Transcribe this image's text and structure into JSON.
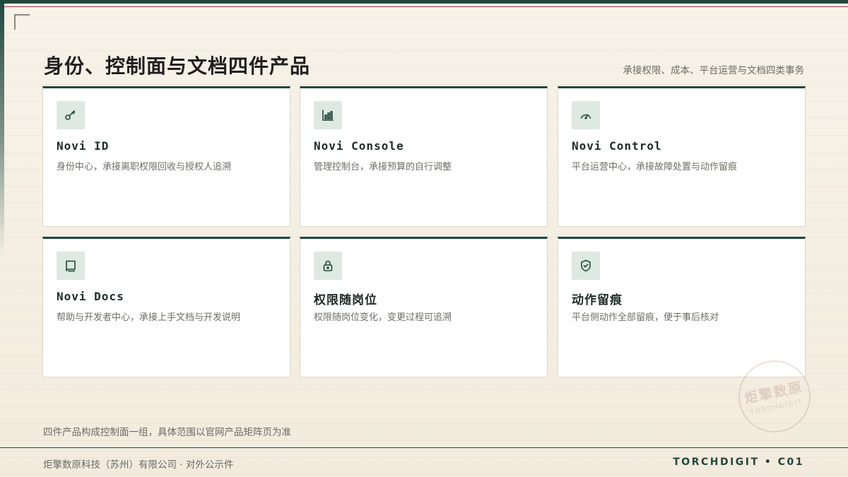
{
  "slide": {
    "title": "身份、控制面与文档四件产品",
    "subtitle": "承接权限、成本、平台运营与文档四类事务"
  },
  "cards": [
    {
      "name": "Novi ID",
      "description": "身份中心，承接离职权限回收与授权人追溯",
      "icon": "key-icon"
    },
    {
      "name": "Novi Console",
      "description": "管理控制台，承接预算的自行调整",
      "icon": "bar-chart-icon"
    },
    {
      "name": "Novi Control",
      "description": "平台运营中心，承接故障处置与动作留痕",
      "icon": "gauge-icon"
    },
    {
      "name": "Novi Docs",
      "description": "帮助与开发者中心，承接上手文档与开发说明",
      "icon": "book-icon"
    },
    {
      "name": "权限随岗位",
      "description": "权限随岗位变化，变更过程可追溯",
      "icon": "lock-icon"
    },
    {
      "name": "动作留痕",
      "description": "平台侧动作全部留痕，便于事后核对",
      "icon": "shield-check-icon"
    }
  ],
  "note": "四件产品构成控制面一组，具体范围以官网产品矩阵页为准",
  "footer": {
    "company": "炬擎数原科技（苏州）有限公司 · 对外公示件",
    "code": "TORCHDIGIT • C01"
  },
  "seal": {
    "cn": "炬擎数原",
    "en": "TORCHDIGIT"
  },
  "colors": {
    "accent": "#21473d",
    "accent_red": "#8d3a32",
    "icon_bg": "#dde9e2",
    "background": "#f5efe4"
  }
}
